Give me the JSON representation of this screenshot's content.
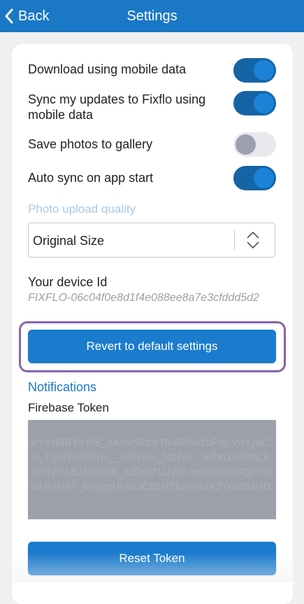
{
  "header": {
    "back_label": "Back",
    "title": "Settings"
  },
  "settings": [
    {
      "label": "Download using mobile data",
      "on": true
    },
    {
      "label": "Sync my updates to Fixflo using mobile data",
      "on": true
    },
    {
      "label": "Save photos to gallery",
      "on": false
    },
    {
      "label": "Auto sync on app start",
      "on": true
    }
  ],
  "photo_quality": {
    "label": "Photo upload quality",
    "value": "Original Size"
  },
  "device": {
    "label": "Your device Id",
    "id": "FIXFLO-06c04f0e8d1f4e088ee8a7e3cfddd5d2"
  },
  "revert_button": "Revert to default settings",
  "notifications": {
    "heading": "Notifications",
    "token_label": "Firebase Token",
    "token": "eYXH9BYXI0B_hXr6mRaVT0:APA91bFIs_VqYj4iCS_TJHR5dG9rH__J6PHSc_Nb1eC_Srlbh1A9l6tCkdUYZFLB1h0jBsl6_wZbw71UWK-wnVis6fhiSQP30jwkRzH4F_iGlbgcUf4loJC81HZfueN1nKJY0bDGHD"
  },
  "reset_button": "Reset Token",
  "colors": {
    "primary": "#1a78c6",
    "toggle_on": "#1565a6",
    "highlight": "#8a63a9"
  }
}
